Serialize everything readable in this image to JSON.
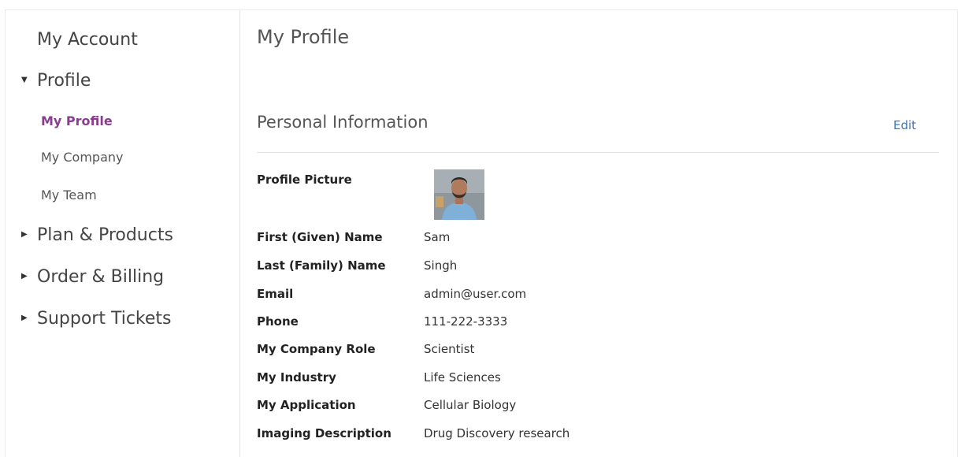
{
  "sidebar": {
    "title": "My Account",
    "sections": [
      {
        "label": "Profile",
        "expanded": true
      },
      {
        "label": "Plan & Products",
        "expanded": false
      },
      {
        "label": "Order & Billing",
        "expanded": false
      },
      {
        "label": "Support Tickets",
        "expanded": false
      }
    ],
    "profile_items": [
      {
        "label": "My Profile",
        "active": true
      },
      {
        "label": "My Company",
        "active": false
      },
      {
        "label": "My Team",
        "active": false
      }
    ]
  },
  "main": {
    "title": "My Profile",
    "section_title": "Personal Information",
    "edit_label": "Edit",
    "fields": [
      {
        "label": "Profile Picture",
        "value": ""
      },
      {
        "label": "First (Given) Name",
        "value": "Sam"
      },
      {
        "label": "Last (Family) Name",
        "value": "Singh"
      },
      {
        "label": "Email",
        "value": "admin@user.com"
      },
      {
        "label": "Phone",
        "value": "111-222-3333"
      },
      {
        "label": "My Company Role",
        "value": "Scientist"
      },
      {
        "label": "My Industry",
        "value": "Life Sciences"
      },
      {
        "label": "My Application",
        "value": "Cellular Biology"
      },
      {
        "label": "Imaging Description",
        "value": "Drug Discovery research"
      }
    ]
  },
  "colors": {
    "active_nav": "#8a3d8f",
    "link": "#3a73b8",
    "divider": "#e3e3e3"
  },
  "icons": {
    "expanded": "caret-down-icon",
    "collapsed": "caret-right-icon"
  }
}
